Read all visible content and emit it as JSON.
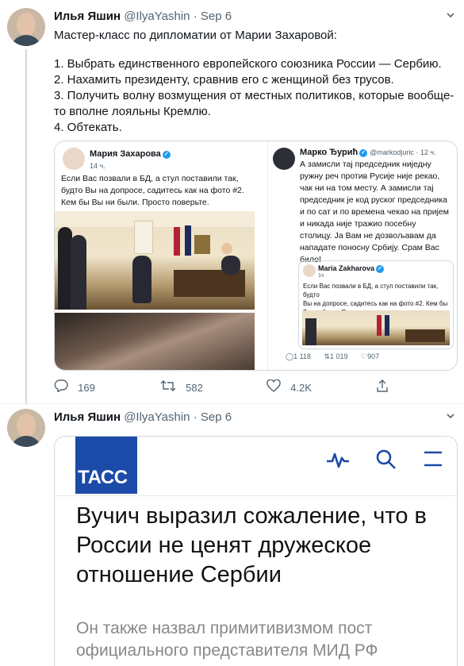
{
  "tweets": [
    {
      "author_name": "Илья Яшин",
      "author_handle": "@IlyaYashin",
      "date": "· Sep 6",
      "lines": [
        "Мастер-класс по дипломатии от Марии Захаровой:",
        "",
        "1. Выбрать единственного европейского союзника России — Сербию.",
        "2. Нахамить президенту, сравнив его с женщиной без трусов.",
        "3. Получить волну возмущения от местных политиков, которые вообще-",
        "то вполне лояльны Кремлю.",
        "4. Обтекать."
      ],
      "media": {
        "left_card": {
          "name": "Мария Захарова",
          "time": "14 ч.",
          "text": [
            "Если Вас позвали в БД, а стул поставили так,",
            "будто Вы на допросе, садитесь как на фото #2.",
            "Кем бы Вы ни были. Просто поверьте."
          ]
        },
        "right_card": {
          "name": "Марко Ђурић",
          "handle": "@markodjuric · 12 ч.",
          "text": [
            "А замисли тај председник ниједну",
            "ружну реч против Русије није рекао,",
            "чак ни на том месту. А замисли тај",
            "председник је код руског председника",
            "и по сат и по времена чекао на пријем",
            "и никада није тражио посебну",
            "столицу. Ја Вам не дозвољавам да",
            "нападате поносну Србију. Срам Вас",
            "било!"
          ],
          "quote": {
            "name": "Maria Zakharova",
            "time": "1ч",
            "text": [
              "Если Вас позвали в БД, а стул поставили так, будто",
              "Вы на допросе, садитесь как на фото #2. Кем бы",
              "Вы ни были. Просто поверьте."
            ]
          },
          "stats": [
            "1 118",
            "1 019",
            "907"
          ]
        }
      },
      "actions": {
        "reply_count": "169",
        "retweet_count": "582",
        "like_count": "4.2K"
      }
    },
    {
      "author_name": "Илья Яшин",
      "author_handle": "@IlyaYashin",
      "date": "· Sep 6",
      "tass": {
        "logo": "ТАСС",
        "headline": "Вучич выразил сожаление, что в России не ценят дружеское отношение Сербии",
        "subtitle": "Он также назвал примитивизмом пост официального представителя МИД РФ"
      }
    }
  ],
  "icons": {
    "more": "chevron-down-icon",
    "reply": "reply-icon",
    "retweet": "retweet-icon",
    "like": "heart-icon",
    "share": "share-icon",
    "pulse": "pulse-icon",
    "search": "search-icon",
    "menu": "menu-icon"
  },
  "colors": {
    "link_blue": "#1d9bf0",
    "tass_blue": "#1c4aa8",
    "muted": "#536471"
  }
}
